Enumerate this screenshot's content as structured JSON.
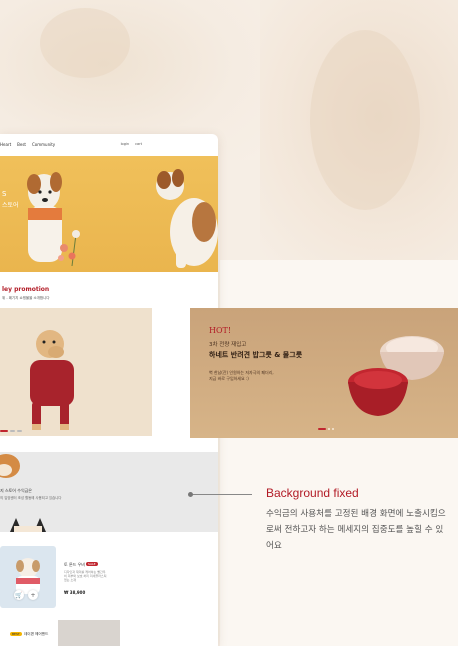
{
  "nav": {
    "items": [
      "Heart",
      "Best",
      "Community"
    ],
    "right": [
      "login",
      "cart"
    ]
  },
  "hero": {
    "title": "S",
    "subtitle": "스토어"
  },
  "promotion": {
    "title": "ley promotion",
    "subtitle": "위 - 페기지 쇼핑몰을 소개합니다"
  },
  "bg_fixed_section": {
    "line1": "지 스토어 수익금은",
    "line2": "의 입양센터 조성 활동에 사용되고 있습니다"
  },
  "product": {
    "name": "토 룬드 우비",
    "badge": "SALE",
    "desc": "디자인과 재미를 케어하는 빨간우비 피부와 보호 처리 미세플라스틱 없는 소재",
    "price": "₩ 38,900"
  },
  "bottom": {
    "badge": "BEST",
    "title": "데이편 헤어밴드"
  },
  "promo_card": {
    "hot": "HOT!",
    "kicker": "3차 전량 재입고",
    "headline": "하네트 반려견 밥그릇 & 물그릇",
    "body1": "벽 한남(잔) 인원하는 저자극의 페더리,",
    "body2": "지금 바로 구입하세요 :)"
  },
  "annotation": {
    "title": "Background fixed",
    "description": "수익금의 사용처를 고정된 배경 화면에 노출시킴으로써 전하고자 하는 메세지의 집중도를 높힐 수 있어요"
  },
  "colors": {
    "accent": "#b21b26",
    "hero_bg": "#eab54e",
    "page_bg": "#f6eee5"
  }
}
